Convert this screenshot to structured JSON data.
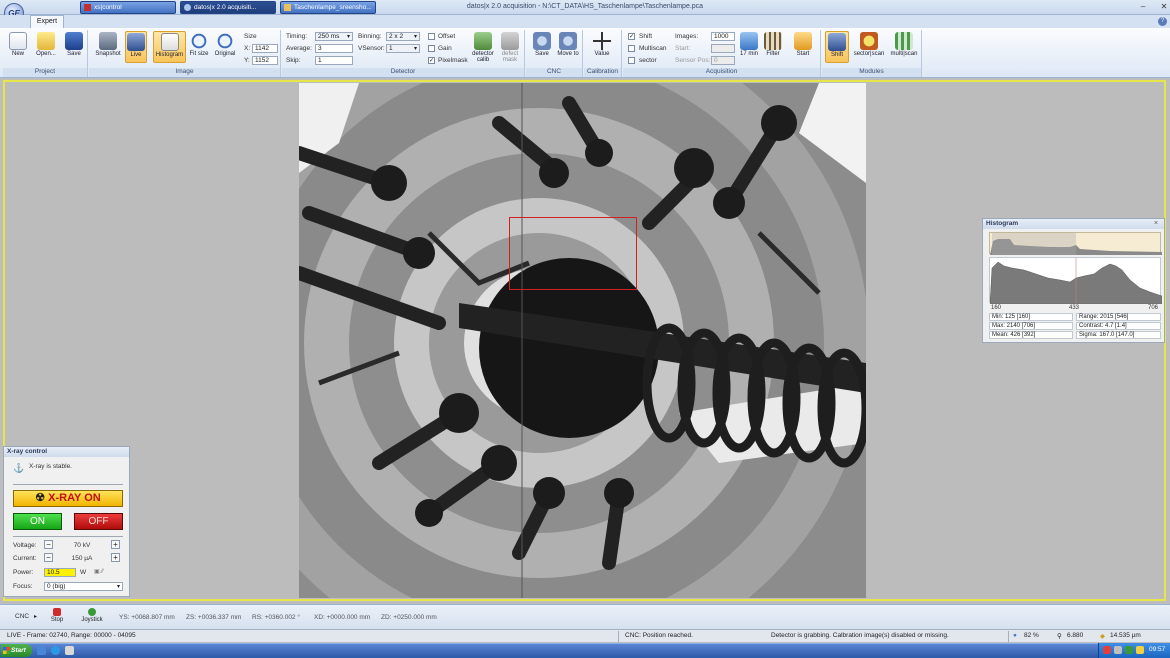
{
  "window": {
    "title": "datos|x 2.0 acquisition - N:\\CT_DATA\\HS_Taschenlampe\\Taschenlampe.pca",
    "logo": "GE"
  },
  "tabs": [
    "Expert"
  ],
  "ribbon": {
    "project": {
      "label": "Project",
      "buttons": [
        "New",
        "Open...",
        "Save"
      ]
    },
    "image": {
      "label": "Image",
      "buttons": [
        "Snapshot",
        "Live",
        "Histogram",
        "Fit size",
        "Original"
      ],
      "size_label": "Size",
      "x_label": "X:",
      "x_value": "1142",
      "y_label": "Y:",
      "y_value": "1152"
    },
    "detector": {
      "label": "Detector",
      "timing_label": "Timing:",
      "timing_value": "250 ms",
      "average_label": "Average:",
      "average_value": "3",
      "skip_label": "Skip:",
      "skip_value": "1",
      "binning_label": "Binning:",
      "binning_value": "2 x 2",
      "vsensor_label": "VSensor:",
      "vsensor_value": "1",
      "offset_label": "Offset",
      "gain_label": "Gain",
      "pixelmask_label": "Pixelmask",
      "calib_label": "detector calib",
      "defect_label": "defect mask"
    },
    "cnc": {
      "label": "CNC",
      "save_label": "Save",
      "moveto_label": "Move to"
    },
    "calibration": {
      "label": "Calibration",
      "value_label": "Value"
    },
    "acquisition": {
      "label": "Acquisition",
      "shift_label": "Shift",
      "multiscan_label": "Multiscan",
      "sector_label": "sector",
      "images_label": "Images:",
      "images_value": "1000",
      "start_label": "Start:",
      "sensorpos_label": "Sensor Pos:",
      "sensorpos_value": "0",
      "time_label": "17 min",
      "filter_label": "Filter",
      "start_btn": "Start"
    },
    "modules": {
      "label": "Modules",
      "buttons": [
        "Shift",
        "sector|scan",
        "multi|scan"
      ]
    }
  },
  "histogram": {
    "title": "Histogram",
    "axis": [
      "160",
      "433",
      "706"
    ],
    "stats": [
      "Min: 125 [160]",
      "Range: 2015 [546]",
      "Max: 2140 [706]",
      "Contrast: 4.7 [1.4]",
      "Mean: 426 [392]",
      "Sigma: 167.0 [147.0]"
    ]
  },
  "xray": {
    "title": "X-ray control",
    "status": "X-ray is stable.",
    "xray_on": "X-RAY ON",
    "on": "ON",
    "off": "OFF",
    "voltage_label": "Voltage:",
    "voltage_value": "70 kV",
    "current_label": "Current:",
    "current_value": "150 µA",
    "power_label": "Power:",
    "power_value": "10.5",
    "power_unit": "W",
    "focus_label": "Focus:",
    "focus_value": "0 (big)"
  },
  "cnc_bar": {
    "cnc_label": "CNC",
    "stop_label": "Stop",
    "joystick_label": "Joystick",
    "ys": "YS: +0068.807 mm",
    "zs": "ZS: +0036.337 mm",
    "rs": "RS: +0360.002 °",
    "xd": "XD: +0000.000 mm",
    "zd": "ZD: +0250.000 mm"
  },
  "status": {
    "live": "LIVE - Frame: 02740, Range: 00000 - 04095",
    "cnc": "CNC: Position reached.",
    "detector": "Detector is grabbing. Calbration image(s) disabled or missing.",
    "zoom": "82 %",
    "magnification": "6.880",
    "voxel": "14.535 µm"
  },
  "taskbar": {
    "start": "Start",
    "tasks": [
      "xs|control",
      "datos|x 2.0 acquisiti...",
      "Taschenlampe_sreensho..."
    ],
    "clock": "09:57"
  },
  "colors": {
    "accent": "#e6e64a",
    "roi": "#d02020",
    "xray_on": "#f2b400",
    "on": "#16a516",
    "off": "#b00c0c"
  }
}
